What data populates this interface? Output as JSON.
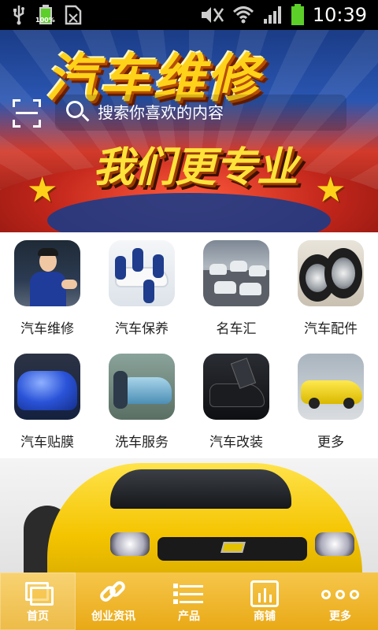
{
  "status_bar": {
    "time": "10:39",
    "battery_label": "100%"
  },
  "banner": {
    "headline": "汽车维修",
    "subheadline": "我们更专业",
    "search": {
      "placeholder": "搜索你喜欢的内容"
    },
    "carousel": {
      "total": 8,
      "active_index": 4
    }
  },
  "categories": [
    {
      "label": "汽车维修",
      "icon": "mechanic-photo"
    },
    {
      "label": "汽车保养",
      "icon": "car-maintenance-photo"
    },
    {
      "label": "名车汇",
      "icon": "luxury-cars-photo"
    },
    {
      "label": "汽车配件",
      "icon": "tires-photo"
    },
    {
      "label": "汽车贴膜",
      "icon": "car-film-photo"
    },
    {
      "label": "洗车服务",
      "icon": "car-wash-photo"
    },
    {
      "label": "汽车改装",
      "icon": "car-modification-photo"
    },
    {
      "label": "更多",
      "icon": "yellow-sports-car-photo"
    }
  ],
  "tabs": [
    {
      "label": "首页",
      "icon": "home-icon",
      "active": true
    },
    {
      "label": "创业资讯",
      "icon": "link-icon",
      "active": false
    },
    {
      "label": "产品",
      "icon": "list-icon",
      "active": false
    },
    {
      "label": "商铺",
      "icon": "shop-chart-icon",
      "active": false
    },
    {
      "label": "更多",
      "icon": "more-dots-icon",
      "active": false
    }
  ],
  "colors": {
    "tabbar": "#f0b42a",
    "banner_blue": "#2a56b2",
    "banner_red": "#d23a2a",
    "headline_yellow": "#ffd21a"
  }
}
